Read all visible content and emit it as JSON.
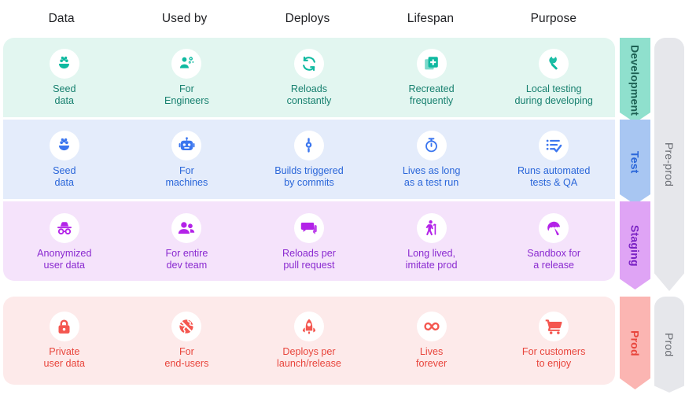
{
  "columns": [
    {
      "label": "Data"
    },
    {
      "label": "Used by"
    },
    {
      "label": "Deploys"
    },
    {
      "label": "Lifespan"
    },
    {
      "label": "Purpose"
    }
  ],
  "groups": [
    {
      "label": "Pre-prod"
    },
    {
      "label": "Prod"
    }
  ],
  "environments": [
    {
      "name": "Development",
      "accent": "#17806f",
      "band": "#e2f6f0",
      "tab": "#8fe0cd",
      "cells": [
        {
          "icon": "seed-sprout-icon",
          "label": "Seed\ndata"
        },
        {
          "icon": "engineer-gears-icon",
          "label": "For\nEngineers"
        },
        {
          "icon": "refresh-loop-icon",
          "label": "Reloads\nconstantly"
        },
        {
          "icon": "duplicate-add-icon",
          "label": "Recreated\nfrequently"
        },
        {
          "icon": "wrench-icon",
          "label": "Local testing\nduring developing"
        }
      ]
    },
    {
      "name": "Test",
      "accent": "#2a66d9",
      "band": "#e4ecfb",
      "tab": "#a8c6f2",
      "cells": [
        {
          "icon": "seed-sprout-icon",
          "label": "Seed\ndata"
        },
        {
          "icon": "robot-icon",
          "label": "For\nmachines"
        },
        {
          "icon": "commit-node-icon",
          "label": "Builds triggered\nby commits"
        },
        {
          "icon": "stopwatch-icon",
          "label": "Lives as long\nas a test run"
        },
        {
          "icon": "checklist-check-icon",
          "label": "Runs automated\ntests & QA"
        }
      ]
    },
    {
      "name": "Staging",
      "accent": "#8a2ad0",
      "band": "#f5e3fb",
      "tab": "#dfa4f5",
      "cells": [
        {
          "icon": "incognito-icon",
          "label": "Anonymized\nuser data"
        },
        {
          "icon": "people-group-icon",
          "label": "For entire\ndev team"
        },
        {
          "icon": "chat-bubbles-icon",
          "label": "Reloads per\npull request"
        },
        {
          "icon": "elderly-person-icon",
          "label": "Long lived,\nimitate prod"
        },
        {
          "icon": "umbrella-icon",
          "label": "Sandbox for\na release"
        }
      ]
    },
    {
      "name": "Prod",
      "accent": "#e8453c",
      "band": "#fdeaea",
      "tab": "#fbb5b2",
      "cells": [
        {
          "icon": "lock-icon",
          "label": "Private\nuser data"
        },
        {
          "icon": "globe-icon",
          "label": "For\nend-users"
        },
        {
          "icon": "rocket-icon",
          "label": "Deploys per\nlaunch/release"
        },
        {
          "icon": "infinity-icon",
          "label": "Lives\nforever"
        },
        {
          "icon": "shopping-cart-icon",
          "label": "For customers\nto enjoy"
        }
      ]
    }
  ]
}
